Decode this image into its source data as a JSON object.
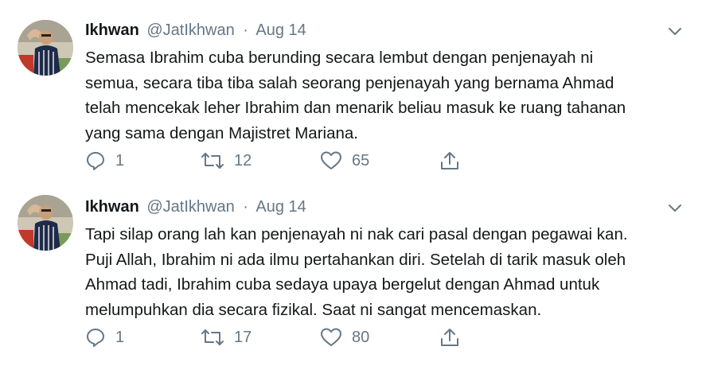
{
  "tweets": [
    {
      "name": "Ikhwan",
      "handle": "@JatIkhwan",
      "dot": "·",
      "date": "Aug 14",
      "text": "Semasa Ibrahim cuba berunding secara lembut dengan penjenayah ni\nsemua, secara tiba tiba salah seorang penjenayah yang bernama Ahmad\ntelah mencekak leher Ibrahim dan menarik beliau masuk ke ruang tahanan\nyang sama dengan Majistret Mariana.",
      "replies": "1",
      "retweets": "12",
      "likes": "65"
    },
    {
      "name": "Ikhwan",
      "handle": "@JatIkhwan",
      "dot": "·",
      "date": "Aug 14",
      "text": "Tapi silap orang lah kan penjenayah ni nak cari pasal dengan pegawai kan.\nPuji Allah, Ibrahim ni ada ilmu pertahankan diri. Setelah di tarik masuk oleh\nAhmad tadi, Ibrahim cuba sedaya upaya bergelut dengan Ahmad untuk\nmelumpuhkan dia secara fizikal. Saat ni sangat mencemaskan.",
      "replies": "1",
      "retweets": "17",
      "likes": "80"
    }
  ],
  "icons": {
    "reply": "reply-icon",
    "retweet": "retweet-icon",
    "like": "heart-icon",
    "share": "share-icon",
    "caret": "chevron-down-icon"
  },
  "colors": {
    "text": "#14171a",
    "secondary": "#657786"
  }
}
